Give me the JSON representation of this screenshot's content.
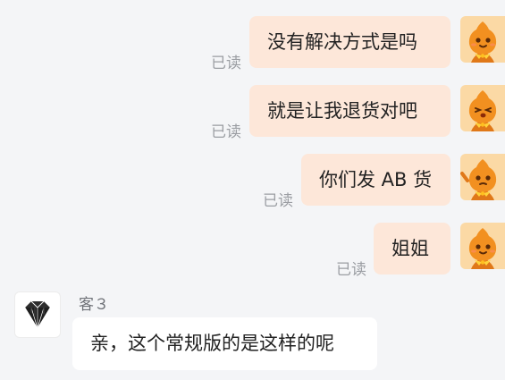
{
  "read_label": "已读",
  "messages_out": [
    {
      "text": "没有解决方式是吗"
    },
    {
      "text": "就是让我退货对吧"
    },
    {
      "text": "你们发 AB 货"
    },
    {
      "text": "姐姐"
    }
  ],
  "incoming": {
    "sender": "客３",
    "text": "亲，这个常规版的是这样的呢"
  },
  "avatar_me_icon": "orange-mascot-icon",
  "avatar_cs_icon": "diamond-icon",
  "colors": {
    "page_bg": "#f4f5f7",
    "bubble_out": "#fde7d9",
    "bubble_in": "#ffffff",
    "read_text": "#9b9ea3",
    "avatar_me_bg": "#fbd9a5",
    "mascot": "#f29020"
  }
}
